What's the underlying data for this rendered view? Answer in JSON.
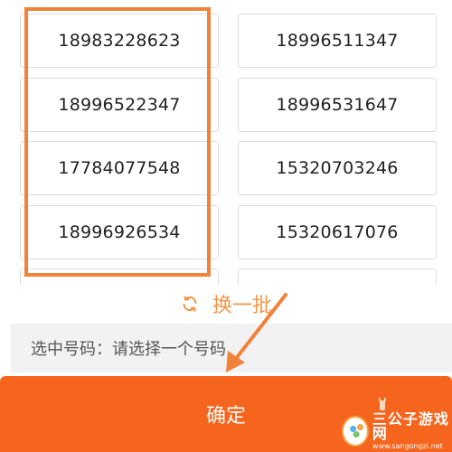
{
  "numbers": {
    "rows": [
      [
        "18983228623",
        "18996511347"
      ],
      [
        "18996522347",
        "18996531647"
      ],
      [
        "17784077548",
        "15320703246"
      ],
      [
        "18996926534",
        "15320617076"
      ]
    ]
  },
  "refresh": {
    "label": "换一批",
    "icon": "refresh-icon"
  },
  "selection": {
    "prefix": "选中号码：",
    "placeholder": "请选择一个号码"
  },
  "confirm": {
    "label": "确定"
  },
  "watermark": {
    "name": "三公子游戏网",
    "url": "www.sangongzi.net"
  },
  "colors": {
    "accent": "#f5651e",
    "highlight": "#f0823a",
    "refresh": "#f39545"
  }
}
